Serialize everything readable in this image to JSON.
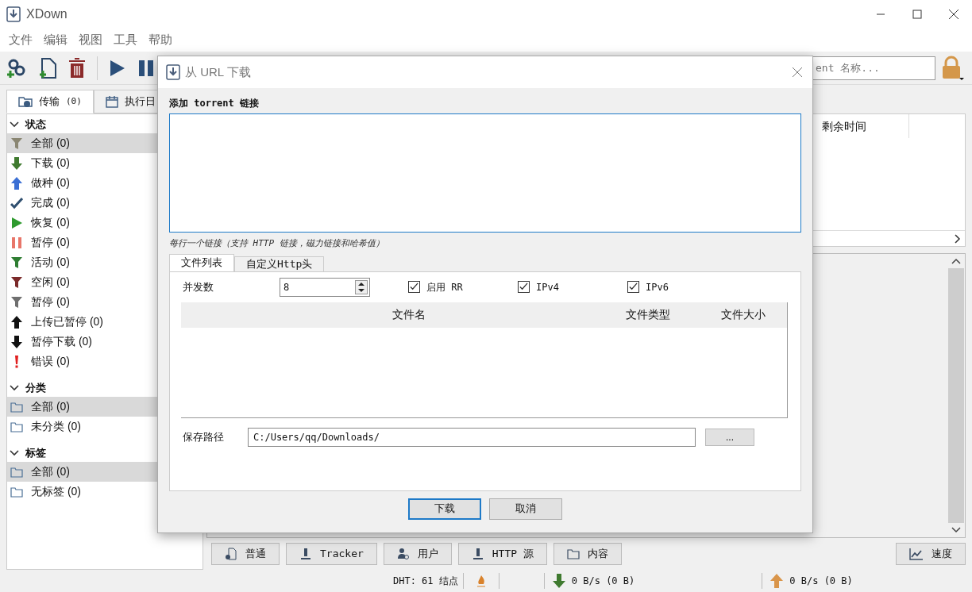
{
  "window": {
    "title": "XDown"
  },
  "menu": [
    "文件",
    "编辑",
    "视图",
    "工具",
    "帮助"
  ],
  "toolbar": {
    "search": {
      "value": "ent 名称..."
    }
  },
  "left_tabs": [
    {
      "label": "传输",
      "count": "(0)",
      "selected": true
    },
    {
      "label": "执行日",
      "selected": false
    }
  ],
  "sections": [
    {
      "title": "状态",
      "expanded": true,
      "items": [
        {
          "kind": "all",
          "label": "全部 (0)",
          "selected": true
        },
        {
          "kind": "download",
          "label": "下载 (0)",
          "selected": false
        },
        {
          "kind": "seed",
          "label": "做种 (0)",
          "selected": false
        },
        {
          "kind": "done",
          "label": "完成 (0)",
          "selected": false
        },
        {
          "kind": "resume",
          "label": "恢复 (0)",
          "selected": false
        },
        {
          "kind": "pause",
          "label": "暂停 (0)",
          "selected": false
        },
        {
          "kind": "active",
          "label": "活动 (0)",
          "selected": false
        },
        {
          "kind": "idle",
          "label": "空闲 (0)",
          "selected": false
        },
        {
          "kind": "paused",
          "label": "暂停 (0)",
          "selected": false
        },
        {
          "kind": "upload-paused",
          "label": "上传已暂停 (0)",
          "selected": false
        },
        {
          "kind": "download-paused",
          "label": "暂停下载 (0)",
          "selected": false
        },
        {
          "kind": "error",
          "label": "错误 (0)",
          "selected": false
        }
      ]
    },
    {
      "title": "分类",
      "expanded": true,
      "items": [
        {
          "kind": "folder",
          "label": "全部 (0)",
          "selected": true
        },
        {
          "kind": "folder",
          "label": "未分类 (0)",
          "selected": false
        }
      ]
    },
    {
      "title": "标签",
      "expanded": true,
      "items": [
        {
          "kind": "folder",
          "label": "全部 (0)",
          "selected": true
        },
        {
          "kind": "folder",
          "label": "无标签 (0)",
          "selected": false
        }
      ]
    }
  ],
  "table": {
    "columns": [
      "剩余时间"
    ]
  },
  "bottom_tabs": [
    {
      "kind": "general",
      "label": "普通"
    },
    {
      "kind": "tracker",
      "label": "Tracker"
    },
    {
      "kind": "users",
      "label": "用户"
    },
    {
      "kind": "tracker",
      "label": "HTTP 源"
    },
    {
      "kind": "folder",
      "label": "内容"
    }
  ],
  "speed_button": "速度",
  "status_bar": {
    "dht": "DHT: 61 结点",
    "download": "0 B/s (0 B)",
    "upload": "0 B/s (0 B)"
  },
  "dialog": {
    "title": "从 URL 下载",
    "links_label": "添加 torrent 链接",
    "hint": "每行一个链接（支持 HTTP 链接，磁力链接和哈希值）",
    "tabs": [
      {
        "label": "文件列表",
        "selected": true
      },
      {
        "label": "自定义Http头",
        "selected": false
      }
    ],
    "concurrency_label": "并发数",
    "concurrency": "8",
    "options": [
      {
        "label": "启用 RR",
        "checked": true
      },
      {
        "label": "IPv4",
        "checked": true
      },
      {
        "label": "IPv6",
        "checked": true
      }
    ],
    "file_columns": [
      "文件名",
      "文件类型",
      "文件大小"
    ],
    "save_label": "保存路径",
    "save_path": "C:/Users/qq/Downloads/",
    "browse": "...",
    "buttons": [
      {
        "label": "下载",
        "selected": true
      },
      {
        "label": "取消",
        "selected": false
      }
    ]
  }
}
